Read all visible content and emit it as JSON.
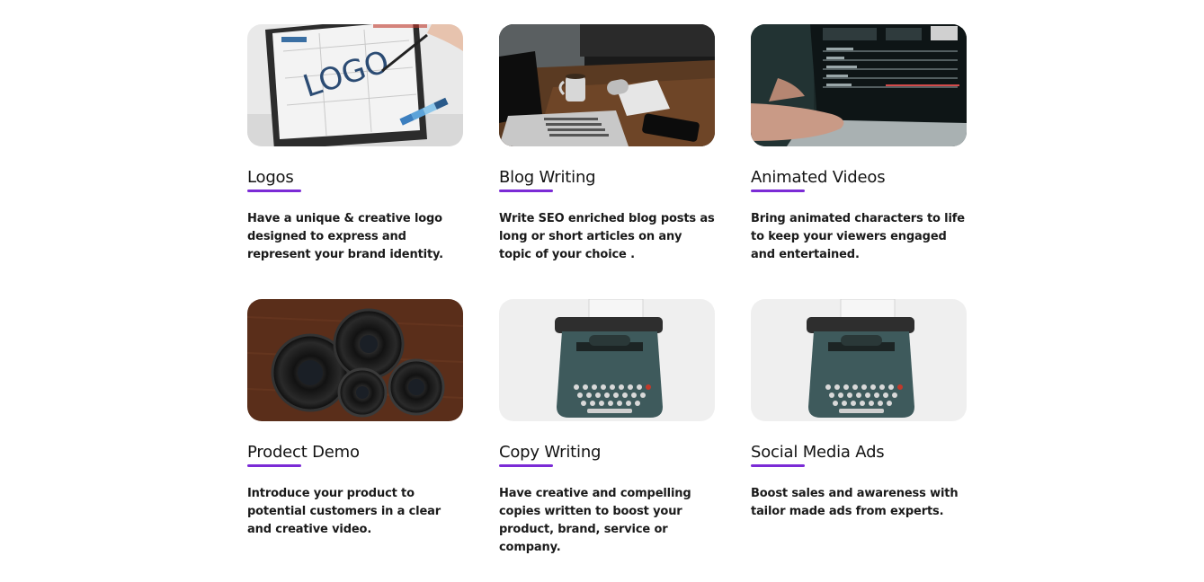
{
  "services": [
    {
      "title": "Logos",
      "description": "Have a unique & creative logo designed to express and represent your brand identity.",
      "image_icon": "logo-design-tablet-image"
    },
    {
      "title": "Blog Writing",
      "description": "Write SEO enriched blog posts as long or short articles on any topic of your choice .",
      "image_icon": "laptop-desk-image"
    },
    {
      "title": "Animated Videos",
      "description": "Bring animated characters to life to keep your viewers engaged and entertained.",
      "image_icon": "video-editing-laptop-image"
    },
    {
      "title": "Prodect Demo",
      "description": "Introduce your product to potential customers in a clear and creative video.",
      "image_icon": "camera-lenses-image"
    },
    {
      "title": "Copy Writing",
      "description": "Have creative and compelling copies written to boost your product, brand, service or company.",
      "image_icon": "typewriter-image"
    },
    {
      "title": "Social Media Ads",
      "description": "Boost sales and awareness with tailor made ads from experts.",
      "image_icon": "typewriter-image"
    }
  ],
  "colors": {
    "accent": "#7b2bd6",
    "text": "#141414",
    "background": "#ffffff"
  }
}
